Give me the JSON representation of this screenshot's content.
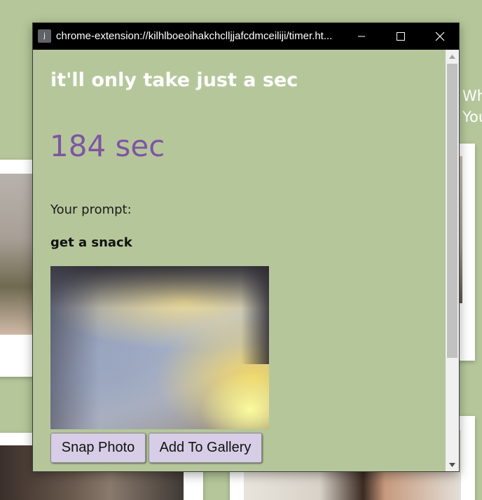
{
  "window": {
    "title": "chrome-extension://kilhlboeoihakchclljjafcdmceiliji/timer.ht...",
    "favicon_letter": "j",
    "controls": [
      "minimize-icon",
      "maximize-icon",
      "close-icon"
    ]
  },
  "page": {
    "heading": "it'll only take just a sec",
    "timer": "184 sec",
    "prompt_label": "Your prompt:",
    "prompt_value": "get a snack",
    "buttons": {
      "snap": "Snap Photo",
      "add": "Add To Gallery"
    }
  },
  "background": {
    "text_line1": "Wh",
    "text_line2": "You"
  },
  "colors": {
    "page_background": "#b5c79a",
    "timer": "#7e55a3",
    "heading": "#ffffff",
    "button_background": "#d7cde6",
    "titlebar": "#000000"
  }
}
